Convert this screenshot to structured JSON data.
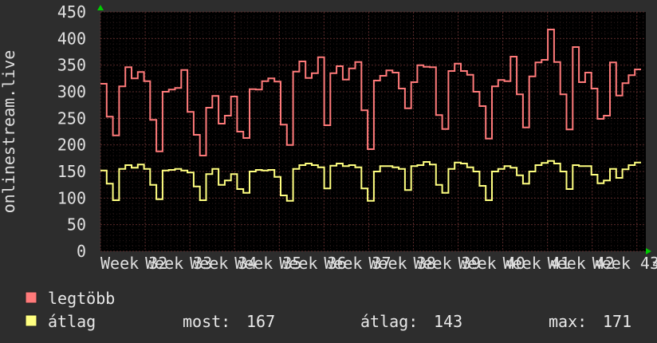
{
  "chart_data": {
    "type": "line",
    "ylabel": "onlinestream.live",
    "ylim": [
      0,
      450
    ],
    "y_ticks": [
      0,
      50,
      100,
      150,
      200,
      250,
      300,
      350,
      400,
      450
    ],
    "x_tick_labels": [
      "Week 32",
      "Week 33",
      "Week 34",
      "Week 35",
      "Week 36",
      "Week 37",
      "Week 38",
      "Week 39",
      "Week 40",
      "Week 41",
      "Week 42",
      "Week 43"
    ],
    "x_tail_label": "4",
    "grid": true,
    "background": "#000000",
    "grid_color": "#3a2020",
    "axis_arrow_color": "#00cc00",
    "series": [
      {
        "name": "legtöbb",
        "color": "#ff7a7a",
        "values": [
          315,
          253,
          218,
          310,
          346,
          325,
          337,
          320,
          247,
          188,
          300,
          304,
          307,
          341,
          262,
          219,
          180,
          270,
          292,
          240,
          255,
          291,
          225,
          213,
          305,
          304,
          320,
          325,
          319,
          238,
          200,
          338,
          357,
          326,
          335,
          365,
          237,
          335,
          348,
          323,
          344,
          356,
          265,
          192,
          321,
          330,
          340,
          336,
          306,
          269,
          318,
          350,
          347,
          346,
          256,
          230,
          339,
          353,
          339,
          332,
          300,
          273,
          212,
          310,
          322,
          320,
          366,
          295,
          233,
          329,
          355,
          360,
          417,
          356,
          295,
          229,
          384,
          318,
          336,
          306,
          249,
          255,
          355,
          293,
          316,
          331,
          342
        ]
      },
      {
        "name": "átlag",
        "color": "#ffff80",
        "values": [
          152,
          127,
          96,
          155,
          162,
          157,
          163,
          155,
          125,
          98,
          152,
          153,
          155,
          152,
          148,
          122,
          96,
          145,
          155,
          125,
          133,
          145,
          117,
          110,
          150,
          153,
          152,
          153,
          140,
          105,
          95,
          155,
          162,
          165,
          162,
          158,
          118,
          161,
          165,
          160,
          162,
          158,
          118,
          95,
          150,
          160,
          160,
          158,
          155,
          115,
          160,
          162,
          168,
          163,
          125,
          110,
          155,
          167,
          165,
          158,
          150,
          123,
          96,
          150,
          155,
          160,
          157,
          143,
          127,
          150,
          162,
          166,
          170,
          165,
          150,
          117,
          162,
          160,
          160,
          144,
          128,
          133,
          155,
          138,
          154,
          162,
          167
        ]
      }
    ]
  },
  "legend": {
    "series1_label": "legtöbb",
    "series2_label": "átlag",
    "now_label": "most:",
    "now_value": "167",
    "avg_label": "átlag:",
    "avg_value": "143",
    "max_label": "max:",
    "max_value": "171"
  }
}
